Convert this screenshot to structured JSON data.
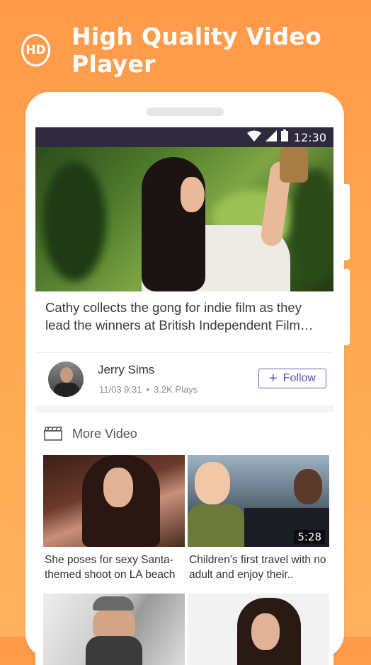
{
  "banner": {
    "badge": "HD",
    "title": "High Quality Video Player"
  },
  "status_bar": {
    "time": "12:30",
    "icons": [
      "wifi-icon",
      "signal-icon",
      "battery-icon"
    ]
  },
  "article": {
    "title": "Cathy collects the gong for indie film as they lead the winners at British Independent Film…"
  },
  "author": {
    "name": "Jerry Sims",
    "date": "11/03 9:31",
    "separator": "•",
    "plays": "3.2K Plays",
    "follow_label": "Follow",
    "follow_icon": "+"
  },
  "more": {
    "title": "More Video",
    "icon": "clapperboard-icon",
    "videos": [
      {
        "title": "She poses for sexy Santa-themed shoot on LA beach",
        "duration": ""
      },
      {
        "title": "Children’s first travel with no adult and enjoy their..",
        "duration": "5:28"
      },
      {
        "title": "",
        "duration": ""
      },
      {
        "title": "",
        "duration": ""
      }
    ]
  },
  "colors": {
    "background": "#ff9f4e",
    "accent": "#5a4fb3",
    "status_bar": "#2f2a3d"
  }
}
